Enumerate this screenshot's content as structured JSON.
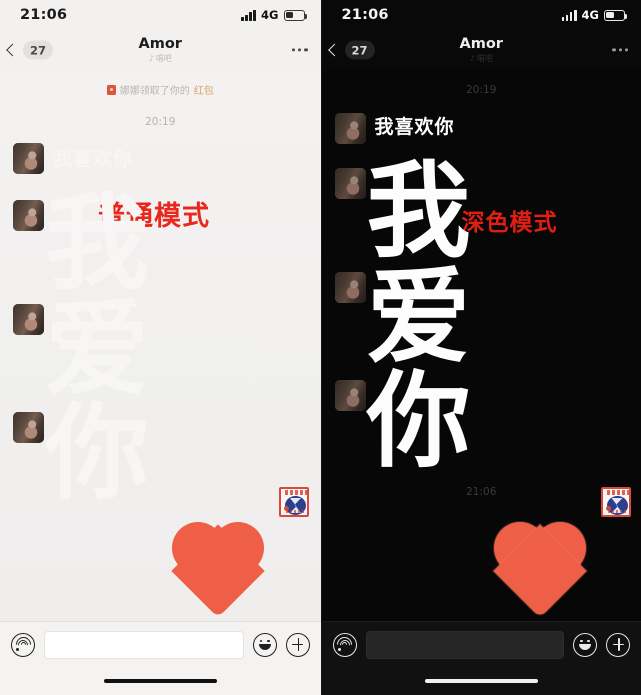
{
  "meta": {
    "accent_red": "#e8281e",
    "heart_color": "#ef5e47",
    "dark_bg": "#090909",
    "light_bg": "#f2f1f0"
  },
  "light_panel": {
    "status": {
      "time": "21:06",
      "network": "4G"
    },
    "nav": {
      "back_badge": "27",
      "title": "Amor",
      "subtitle": "唱吧",
      "more": "···"
    },
    "system_note": {
      "prefix": "娜娜领取了你的",
      "highlight": "红包"
    },
    "timestamp": "20:19",
    "mode_label": "普通模式",
    "hidden_message_small": "我喜欢你",
    "hidden_message_big": [
      "我",
      "爱",
      "你"
    ],
    "input": {
      "voice_icon": "voice-wave-icon",
      "placeholder": "",
      "value": "",
      "emoji_icon": "smiley-icon",
      "plus_icon": "plus-icon"
    }
  },
  "dark_panel": {
    "status": {
      "time": "21:06",
      "network": "4G"
    },
    "nav": {
      "back_badge": "27",
      "title": "Amor",
      "subtitle": "唱吧",
      "more": "···"
    },
    "timestamp_top": "20:19",
    "timestamp_bottom": "21:06",
    "mode_label": "深色模式",
    "message_small": "我喜欢你",
    "message_big": [
      "我",
      "爱",
      "你"
    ],
    "input": {
      "voice_icon": "voice-wave-icon",
      "placeholder": "",
      "value": "",
      "emoji_icon": "smiley-icon",
      "plus_icon": "plus-icon"
    }
  }
}
